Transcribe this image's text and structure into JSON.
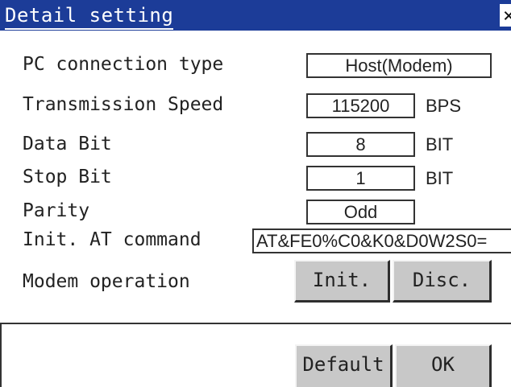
{
  "window": {
    "title": "Detail setting",
    "close_label": "×"
  },
  "rows": [
    {
      "label": "PC connection type",
      "value": "Host(Modem)",
      "unit": ""
    },
    {
      "label": "Transmission Speed",
      "value": "115200",
      "unit": "BPS"
    },
    {
      "label": "Data Bit",
      "value": "8",
      "unit": "BIT"
    },
    {
      "label": "Stop Bit",
      "value": "1",
      "unit": "BIT"
    },
    {
      "label": "Parity",
      "value": "Odd",
      "unit": ""
    }
  ],
  "init_at": {
    "label": "Init. AT command",
    "value": "AT&FE0%C0&K0&D0W2S0="
  },
  "modem": {
    "label": "Modem operation",
    "init_button": "Init.",
    "disc_button": "Disc."
  },
  "footer": {
    "default_button": "Default",
    "ok_button": "OK"
  }
}
